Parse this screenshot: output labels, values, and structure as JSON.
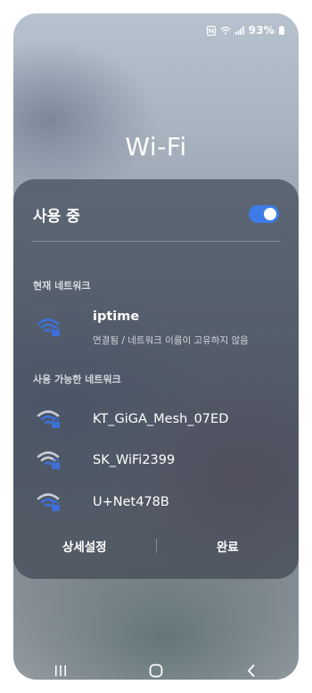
{
  "status_bar": {
    "battery": "93%",
    "icons": [
      "nfc-icon",
      "wifi-icon",
      "signal-icon",
      "battery-icon"
    ]
  },
  "title": "Wi-Fi",
  "toggle": {
    "label": "사용 중",
    "enabled": true
  },
  "current_section": "현재 네트워크",
  "current_network": {
    "name": "iptime",
    "status": "연결됨 / 네트워크 이름이 고유하지 않음",
    "icon": "wifi-lock-icon"
  },
  "available_section": "사용 가능한 네트워크",
  "available_networks": [
    {
      "name": "KT_GiGA_Mesh_07ED",
      "icon": "wifi-lock-icon"
    },
    {
      "name": "SK_WiFi2399",
      "icon": "wifi-lock-icon"
    },
    {
      "name": "U+Net478B",
      "icon": "wifi-lock-icon"
    }
  ],
  "actions": {
    "settings": "상세설정",
    "done": "완료"
  },
  "nav": [
    "recents-icon",
    "home-icon",
    "back-icon"
  ],
  "colors": {
    "accent": "#3e7be6",
    "wifi_signal": "#3d6fd6",
    "wifi_dim": "#c8cdd6"
  }
}
